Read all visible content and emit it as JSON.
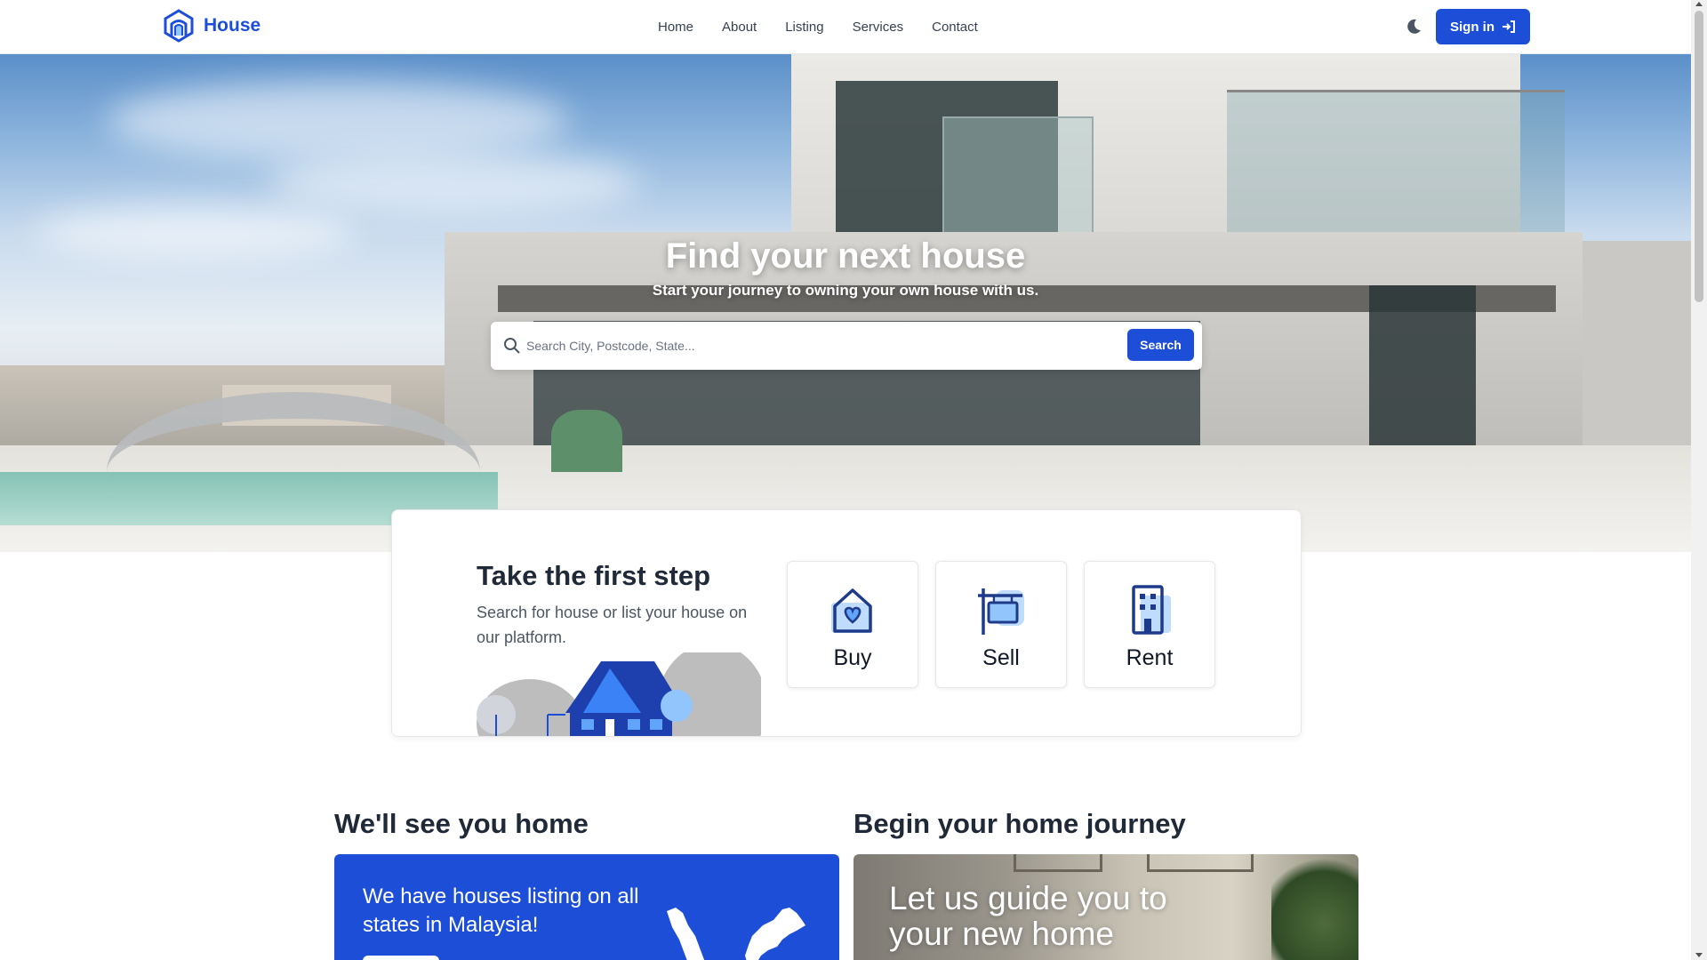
{
  "brand": {
    "name": "House",
    "logo_icon": "house-logo-icon"
  },
  "nav": {
    "links": [
      {
        "label": "Home"
      },
      {
        "label": "About"
      },
      {
        "label": "Listing"
      },
      {
        "label": "Services"
      },
      {
        "label": "Contact"
      }
    ],
    "theme_icon": "moon-icon",
    "signin_label": "Sign in",
    "signin_icon": "sign-in-icon"
  },
  "hero": {
    "title": "Find your next house",
    "subtitle": "Start your journey to owning your own house with us.",
    "search_placeholder": "Search City, Postcode, State...",
    "search_button": "Search"
  },
  "first_step": {
    "title": "Take the first step",
    "description": "Search for house or list your house on our platform.",
    "options": [
      {
        "label": "Buy",
        "icon": "house-heart-icon"
      },
      {
        "label": "Sell",
        "icon": "sell-sign-icon"
      },
      {
        "label": "Rent",
        "icon": "building-icon"
      }
    ]
  },
  "sections": {
    "left_title": "We'll see you home",
    "right_title": "Begin your home journey",
    "left_card_text": "We have houses listing on all states in Malaysia!",
    "right_card_text": "Let us guide you to your new home"
  },
  "colors": {
    "primary": "#1d4ed8",
    "text": "#1f2937",
    "muted": "#4b5563"
  }
}
